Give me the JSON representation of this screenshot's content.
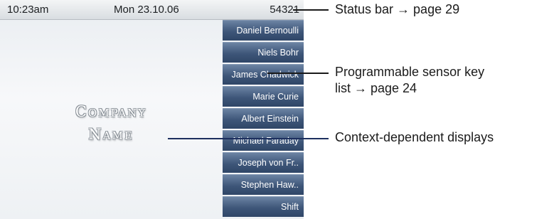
{
  "status_bar": {
    "time": "10:23am",
    "date": "Mon 23.10.06",
    "number": "54321"
  },
  "company_name": {
    "line1": {
      "initial": "C",
      "rest": "OMPANY"
    },
    "line2": {
      "initial": "N",
      "rest": "AME"
    }
  },
  "sensor_keys": [
    {
      "label": "Daniel Bernoulli"
    },
    {
      "label": "Niels Bohr"
    },
    {
      "label": "James Chadwick"
    },
    {
      "label": "Marie Curie"
    },
    {
      "label": "Albert Einstein"
    },
    {
      "label": "Michael Faraday"
    },
    {
      "label": "Joseph von Fr.."
    },
    {
      "label": "Stephen Haw.."
    },
    {
      "label": "Shift"
    }
  ],
  "callouts": {
    "status_bar": "Status bar → page 29",
    "sensor_key_list_line1": "Programmable sensor key",
    "sensor_key_list_line2": "list → page 24",
    "context_displays": "Context-dependent displays"
  }
}
